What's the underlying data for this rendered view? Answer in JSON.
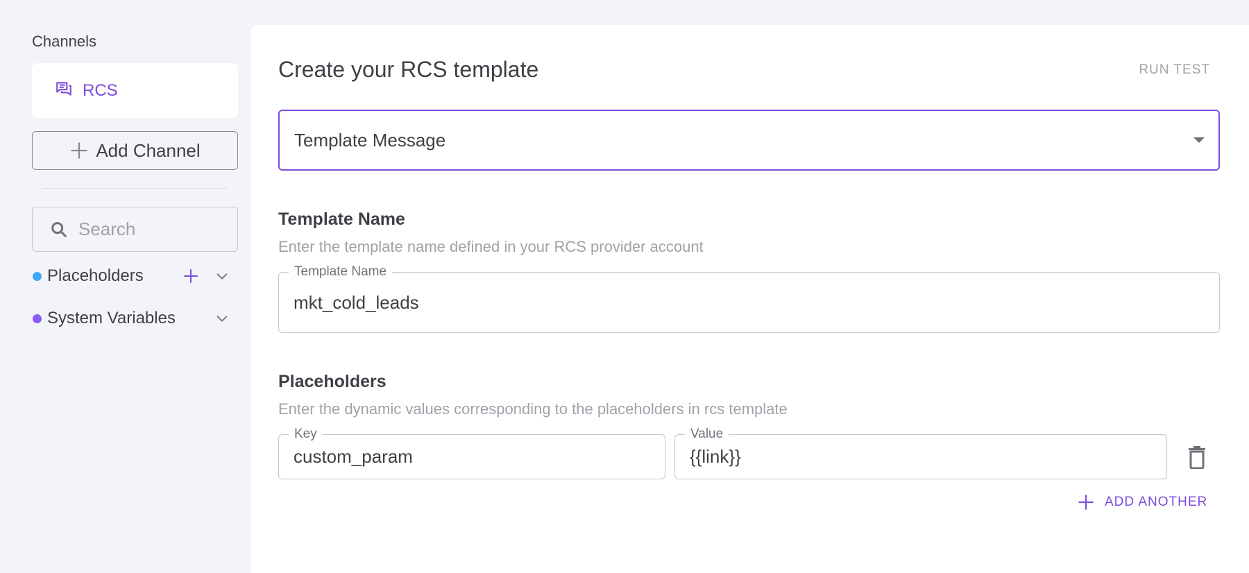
{
  "sidebar": {
    "channels_label": "Channels",
    "channel": {
      "label": "RCS",
      "icon": "chat-bubble-icon"
    },
    "add_channel_label": "Add Channel",
    "search_placeholder": "Search",
    "variables": [
      {
        "label": "Placeholders",
        "dot_color": "#42a5f5",
        "has_add": true
      },
      {
        "label": "System Variables",
        "dot_color": "#8b5cf6",
        "has_add": false
      }
    ]
  },
  "main": {
    "title": "Create your RCS template",
    "run_test_label": "RUN TEST",
    "message_type_select": {
      "value": "Template Message"
    },
    "template_name": {
      "heading": "Template Name",
      "description": "Enter the template name defined in your RCS provider account",
      "field_label": "Template Name",
      "value": "mkt_cold_leads"
    },
    "placeholders": {
      "heading": "Placeholders",
      "description": "Enter the dynamic values corresponding to the placeholders in rcs template",
      "key_label": "Key",
      "value_label": "Value",
      "rows": [
        {
          "key": "custom_param",
          "value": "{{link}}"
        }
      ],
      "add_another_label": "ADD ANOTHER"
    }
  },
  "colors": {
    "accent": "#7c4ddc",
    "background": "#f3f4f9",
    "panel": "#ffffff",
    "muted_text": "#a1a1aa"
  }
}
